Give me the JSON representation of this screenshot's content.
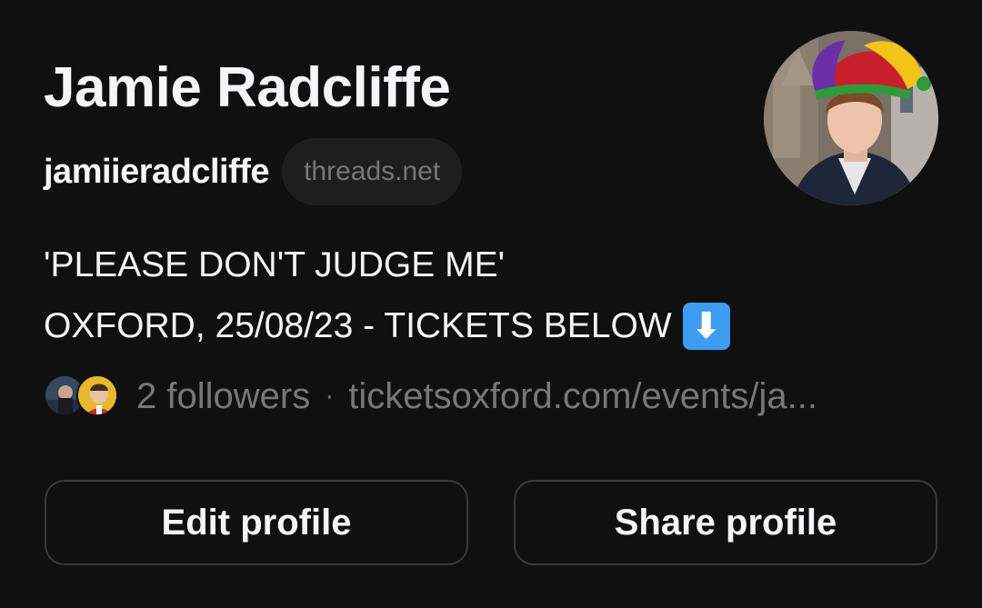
{
  "profile": {
    "display_name": "Jamie Radcliffe",
    "username": "jamiieradcliffe",
    "domain_badge": "threads.net",
    "bio_line1": "'PLEASE DON'T JUDGE ME'",
    "bio_line2": "OXFORD, 25/08/23 - TICKETS BELOW",
    "bio_emoji": "⬇",
    "followers": "2 followers",
    "separator": "·",
    "link": "ticketsoxford.com/events/ja..."
  },
  "actions": {
    "edit_label": "Edit profile",
    "share_label": "Share profile"
  },
  "colors": {
    "background": "#101010",
    "primary_text": "#f3f5f7",
    "secondary_text": "#777777",
    "button_border": "#3a3a3a",
    "emoji_blue": "#3e9cf2"
  },
  "icons": {
    "profile_avatar": "avatar-photo",
    "follower_avatar_1": "avatar-photo",
    "follower_avatar_2": "avatar-photo",
    "bio_emoji": "down-arrow-emoji-icon"
  }
}
